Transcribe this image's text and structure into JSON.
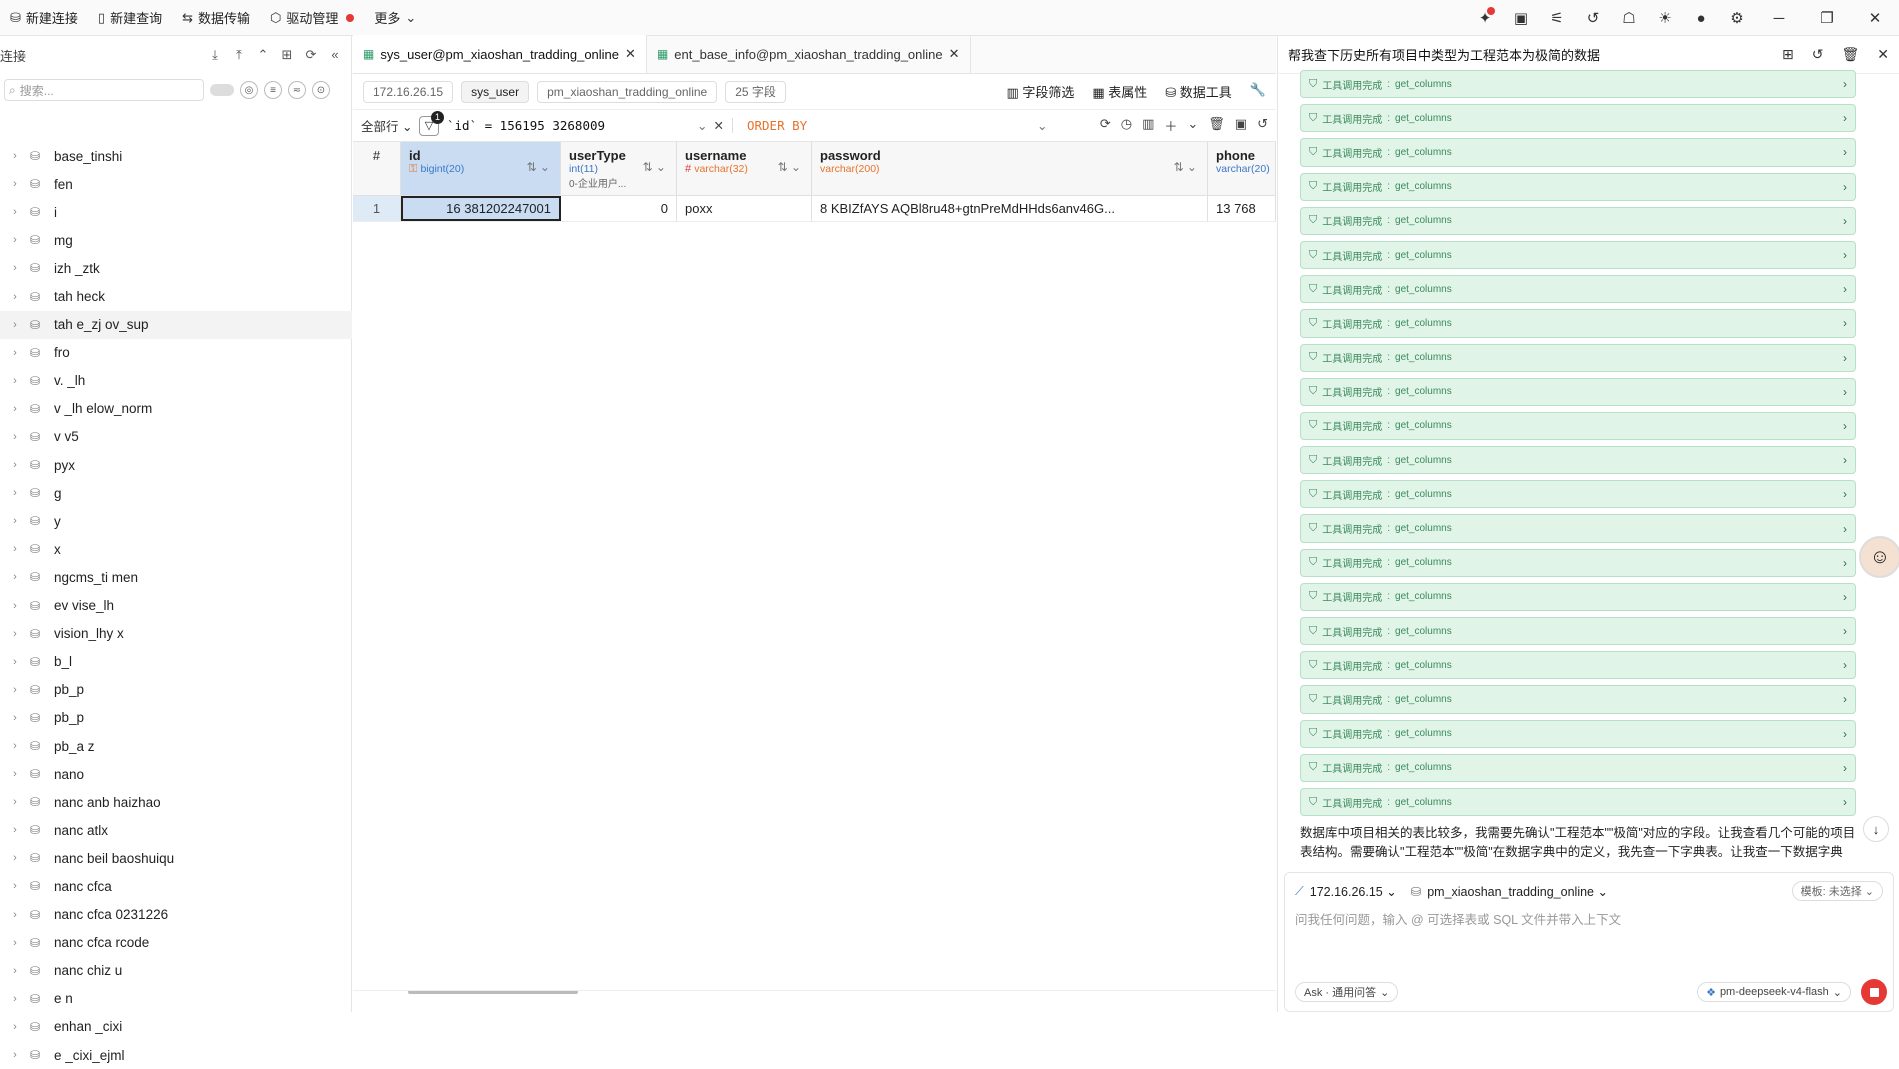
{
  "topbar": {
    "new_connection": "新建连接",
    "new_query": "新建查询",
    "data_transfer": "数据传输",
    "driver_mgmt": "驱动管理",
    "more": "更多"
  },
  "sidebar": {
    "title": "连接",
    "search_placeholder": "搜索...",
    "items": [
      {
        "label": "base_tinshi",
        "blur": false
      },
      {
        "label": "fen",
        "blur": true
      },
      {
        "label": "i",
        "blur": true
      },
      {
        "label": "mg",
        "blur": true
      },
      {
        "label": "izh _ztk",
        "blur": true
      },
      {
        "label": "tah heck",
        "blur": true
      },
      {
        "label": "tah e_zj ov_sup",
        "blur": true
      },
      {
        "label": "fro",
        "blur": true
      },
      {
        "label": "v. _lh",
        "blur": true
      },
      {
        "label": "v _lh elow_norm",
        "blur": true
      },
      {
        "label": "v v5",
        "blur": true
      },
      {
        "label": "pyx",
        "blur": true
      },
      {
        "label": "g",
        "blur": true
      },
      {
        "label": "y",
        "blur": true
      },
      {
        "label": "x",
        "blur": true
      },
      {
        "label": "ngcms_ti men",
        "blur": true
      },
      {
        "label": "ev vise_lh",
        "blur": true
      },
      {
        "label": "vision_lhy x",
        "blur": true
      },
      {
        "label": "b_l",
        "blur": true
      },
      {
        "label": "pb_p",
        "blur": true
      },
      {
        "label": "pb_p",
        "blur": true
      },
      {
        "label": "pb_a z",
        "blur": true
      },
      {
        "label": "nano",
        "blur": true
      },
      {
        "label": "nanc anb haizhao",
        "blur": true
      },
      {
        "label": "nanc atlx",
        "blur": true
      },
      {
        "label": "nanc beil baoshuiqu",
        "blur": true
      },
      {
        "label": "nanc cfca",
        "blur": true
      },
      {
        "label": "nanc cfca 0231226",
        "blur": true
      },
      {
        "label": "nanc cfca rcode",
        "blur": true
      },
      {
        "label": "nanc chiz u",
        "blur": true
      },
      {
        "label": "e n",
        "blur": true
      },
      {
        "label": "enhan _cixi",
        "blur": true
      },
      {
        "label": "e _cixi_ejml",
        "blur": true
      }
    ]
  },
  "tabs": [
    {
      "label": "sys_user@pm_xiaoshan_tradding_online",
      "active": true
    },
    {
      "label": "ent_base_info@pm_xiaoshan_tradding_online",
      "active": false
    }
  ],
  "crumbs": {
    "host": "172.16.26.15",
    "table": "sys_user",
    "db": "pm_xiaoshan_tradding_online",
    "fields": "25 字段",
    "field_filter": "字段筛选",
    "table_props": "表属性",
    "data_tools": "数据工具"
  },
  "filter": {
    "rows": "全部行",
    "badge": "1",
    "where": "`id` = 156195 3268009",
    "order": "ORDER BY"
  },
  "grid": {
    "row_header": "#",
    "columns": [
      {
        "name": "id",
        "type": "bigint(20)",
        "comment": ""
      },
      {
        "name": "userType",
        "type": "int(11)",
        "comment": "0-企业用户..."
      },
      {
        "name": "username",
        "type": "varchar(32)",
        "comment": ""
      },
      {
        "name": "password",
        "type": "varchar(200)",
        "comment": ""
      },
      {
        "name": "phone",
        "type": "varchar(20)",
        "comment": ""
      }
    ],
    "rows": [
      {
        "n": "1",
        "id": "16 381202247001",
        "userType": "0",
        "username": "poxx",
        "password": "8 KBIZfAYS AQBl8ru48+gtnPreMdHHds6anv46G...",
        "phone": "13 768"
      }
    ]
  },
  "chat": {
    "title": "帮我查下历史所有项目中类型为工程范本为极简的数据",
    "tool_label": "工具调用完成",
    "tool_name": "get_columns",
    "tool_count": 22,
    "text": "数据库中项目相关的表比较多，我需要先确认\"工程范本\"\"极简\"对应的字段。让我查看几个可能的项目表结构。需要确认\"工程范本\"\"极简\"在数据字典中的定义，我先查一下字典表。让我查一下数据字典中\"工程范本\"",
    "host": "172.16.26.15",
    "db": "pm_xiaoshan_tradding_online",
    "template": "模板: 未选择",
    "placeholder": "问我任何问题，输入 @ 可选择表或 SQL 文件并带入上下文",
    "mode": "Ask · 通用问答",
    "model": "pm-deepseek-v4-flash"
  },
  "colors": {
    "accent": "#3a78c9",
    "tool_bg": "#e1f4e8",
    "tool_text": "#3b8a5d",
    "order": "#e6732c",
    "send": "#e53935"
  }
}
